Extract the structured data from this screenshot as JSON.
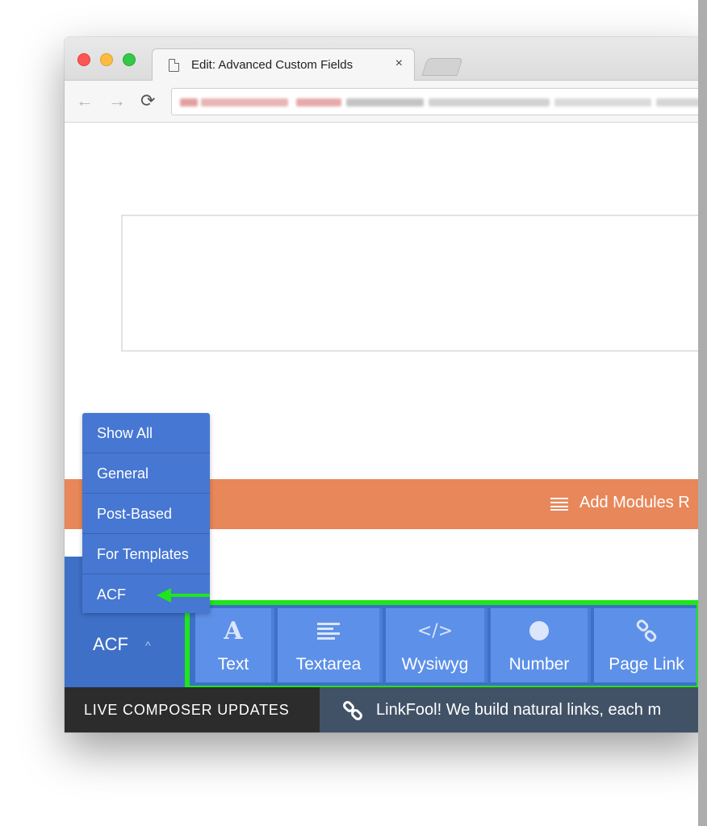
{
  "browser": {
    "tab_title": "Edit: Advanced Custom Fields",
    "tab_close": "×",
    "back_glyph": "←",
    "forward_glyph": "→",
    "reload_glyph": "⟳"
  },
  "page": {
    "orange_bar_label": "Add Modules R"
  },
  "composer": {
    "category_menu": {
      "items": [
        {
          "label": "Show All"
        },
        {
          "label": "General"
        },
        {
          "label": "Post-Based"
        },
        {
          "label": "For Templates"
        },
        {
          "label": "ACF"
        }
      ]
    },
    "current_category": "ACF",
    "current_category_chevron": "^",
    "modules": [
      {
        "label": "Text",
        "icon": "letter-a-icon",
        "glyph": "A"
      },
      {
        "label": "Textarea",
        "icon": "align-left-icon"
      },
      {
        "label": "Wysiwyg",
        "icon": "code-icon",
        "glyph": "</>"
      },
      {
        "label": "Number",
        "icon": "circle-icon"
      },
      {
        "label": "Page Link",
        "icon": "link-icon"
      }
    ]
  },
  "news_bar": {
    "label": "LIVE COMPOSER UPDATES",
    "text": "LinkFool! We build natural links, each m"
  },
  "colors": {
    "highlight": "#1ee61a",
    "panel_blue": "#3e70c7",
    "module_blue": "#5d90e8",
    "orange": "#e8875a",
    "news_bar": "#415267"
  }
}
